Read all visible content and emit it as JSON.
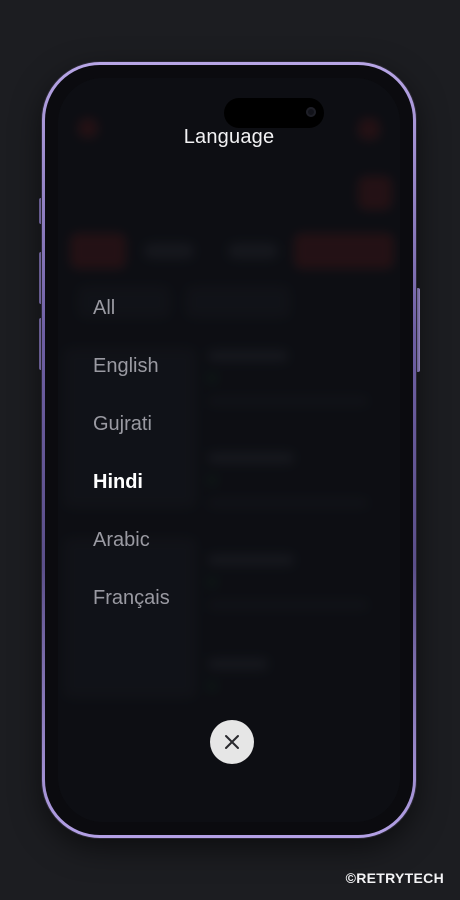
{
  "screen": {
    "title": "Language",
    "selected_language": "Hindi"
  },
  "languages": [
    {
      "label": "All",
      "selected": false
    },
    {
      "label": "English",
      "selected": false
    },
    {
      "label": "Gujrati",
      "selected": false
    },
    {
      "label": "Hindi",
      "selected": true
    },
    {
      "label": "Arabic",
      "selected": false
    },
    {
      "label": "Français",
      "selected": false
    }
  ],
  "icons": {
    "close": "close-icon"
  },
  "watermark": "©RETRYTECH",
  "colors": {
    "background": "#1c1d21",
    "frame_accent": "#b8a6e6",
    "selected_text": "#ffffff",
    "unselected_text": "#9a9aa2",
    "close_button_bg": "#e6e6e6"
  }
}
